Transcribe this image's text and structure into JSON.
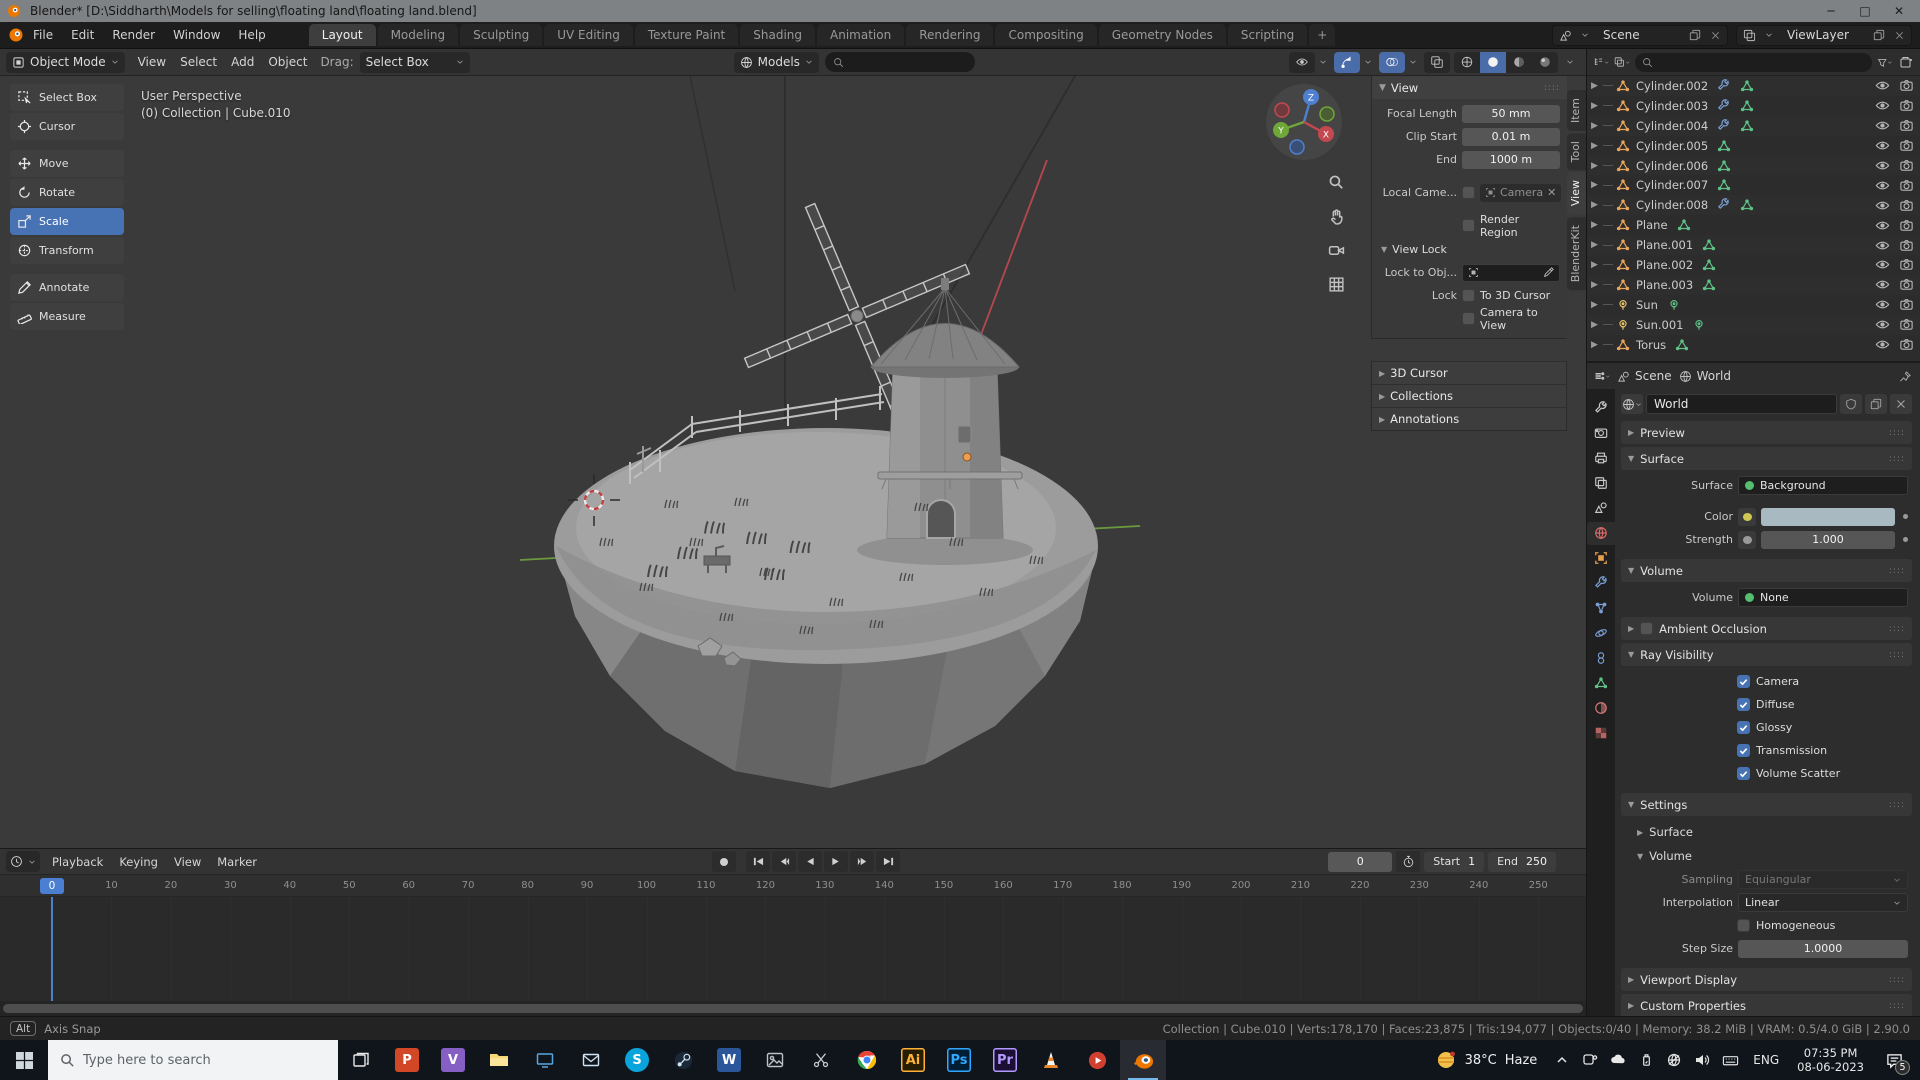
{
  "colors": {
    "accent": "#4772b3",
    "playhead": "#4a7fd1",
    "mesh_orange": "#e9a55b",
    "data_green": "#5fc186",
    "modifier_blue": "#7b9fd4",
    "world_red": "#d96c6c",
    "swatch": "#a9b9c1"
  },
  "window": {
    "title": "Blender* [D:\\Siddharth\\Models for selling\\floating land\\floating land.blend]",
    "minimize": "─",
    "maximize": "□",
    "close": "✕"
  },
  "menubar": {
    "menus": [
      "File",
      "Edit",
      "Render",
      "Window",
      "Help"
    ],
    "workspace_tabs": [
      "Layout",
      "Modeling",
      "Sculpting",
      "UV Editing",
      "Texture Paint",
      "Shading",
      "Animation",
      "Rendering",
      "Compositing",
      "Geometry Nodes",
      "Scripting"
    ],
    "active_tab": "Layout",
    "add_tab": "+",
    "scene_selector": "Scene",
    "viewlayer_selector": "ViewLayer"
  },
  "viewport_header": {
    "mode": "Object Mode",
    "menus": [
      "View",
      "Select",
      "Add",
      "Object"
    ],
    "drag_label": "Drag:",
    "drag_value": "Select Box",
    "asset_lib": "Models"
  },
  "toolbar": {
    "tools": [
      {
        "label": "Select Box",
        "icon": "select-box",
        "active": false,
        "gap": false
      },
      {
        "label": "Cursor",
        "icon": "cursor",
        "active": false,
        "gap": false
      },
      {
        "label": "Move",
        "icon": "move",
        "active": false,
        "gap": true
      },
      {
        "label": "Rotate",
        "icon": "rotate",
        "active": false,
        "gap": false
      },
      {
        "label": "Scale",
        "icon": "scale",
        "active": true,
        "gap": false
      },
      {
        "label": "Transform",
        "icon": "transform",
        "active": false,
        "gap": false
      },
      {
        "label": "Annotate",
        "icon": "annotate",
        "active": false,
        "gap": true
      },
      {
        "label": "Measure",
        "icon": "measure",
        "active": false,
        "gap": false
      }
    ]
  },
  "viewport": {
    "overlay_line1": "User Perspective",
    "overlay_line2": "(0) Collection | Cube.010",
    "gizmo_axes": {
      "x": "X",
      "y": "Y",
      "z": "Z"
    }
  },
  "npanel": {
    "tabs": [
      "Item",
      "Tool",
      "View",
      "BlenderKit"
    ],
    "active_tab": "View",
    "view": {
      "title": "View",
      "focal_length_label": "Focal Length",
      "focal_length": "50 mm",
      "clip_start_label": "Clip Start",
      "clip_start": "0.01 m",
      "end_label": "End",
      "end": "1000 m",
      "local_camera_label": "Local Came...",
      "camera_value": "Camera",
      "render_region_label": "Render Region",
      "view_lock_title": "View Lock",
      "lock_to_obj_label": "Lock to Obj...",
      "lock_label": "Lock",
      "to_3d_cursor_label": "To 3D Cursor",
      "camera_to_view_label": "Camera to View"
    },
    "collapsed_panels": [
      "3D Cursor",
      "Collections",
      "Annotations"
    ]
  },
  "outliner": {
    "rows": [
      {
        "name": "Cylinder.002",
        "type": "mesh",
        "wrench": true
      },
      {
        "name": "Cylinder.003",
        "type": "mesh",
        "wrench": true
      },
      {
        "name": "Cylinder.004",
        "type": "mesh",
        "wrench": true
      },
      {
        "name": "Cylinder.005",
        "type": "mesh",
        "wrench": false
      },
      {
        "name": "Cylinder.006",
        "type": "mesh",
        "wrench": false
      },
      {
        "name": "Cylinder.007",
        "type": "mesh",
        "wrench": false
      },
      {
        "name": "Cylinder.008",
        "type": "mesh",
        "wrench": true
      },
      {
        "name": "Plane",
        "type": "mesh",
        "wrench": false
      },
      {
        "name": "Plane.001",
        "type": "mesh",
        "wrench": false
      },
      {
        "name": "Plane.002",
        "type": "mesh",
        "wrench": false
      },
      {
        "name": "Plane.003",
        "type": "mesh",
        "wrench": false
      },
      {
        "name": "Sun",
        "type": "light",
        "wrench": false
      },
      {
        "name": "Sun.001",
        "type": "light",
        "wrench": false
      },
      {
        "name": "Torus",
        "type": "mesh",
        "wrench": false
      }
    ]
  },
  "properties": {
    "breadcrumb_scene": "Scene",
    "breadcrumb_world": "World",
    "world_block_name": "World",
    "preview_title": "Preview",
    "surface": {
      "title": "Surface",
      "surface_label": "Surface",
      "surface_value": "Background",
      "color_label": "Color",
      "strength_label": "Strength",
      "strength_value": "1.000"
    },
    "volume": {
      "title": "Volume",
      "label": "Volume",
      "value": "None"
    },
    "ao_title": "Ambient Occlusion",
    "ray_visibility": {
      "title": "Ray Visibility",
      "items": [
        {
          "label": "Camera",
          "checked": true
        },
        {
          "label": "Diffuse",
          "checked": true
        },
        {
          "label": "Glossy",
          "checked": true
        },
        {
          "label": "Transmission",
          "checked": true
        },
        {
          "label": "Volume Scatter",
          "checked": true
        }
      ]
    },
    "settings": {
      "title": "Settings",
      "surface_sub": "Surface",
      "volume_sub": "Volume",
      "sampling_label": "Sampling",
      "sampling_value": "Equiangular",
      "interpolation_label": "Interpolation",
      "interpolation_value": "Linear",
      "homogeneous_label": "Homogeneous",
      "step_size_label": "Step Size",
      "step_size_value": "1.0000"
    },
    "viewport_display_title": "Viewport Display",
    "custom_properties_title": "Custom Properties",
    "tabs": [
      {
        "name": "tool",
        "color": "#c8c8c8",
        "active": false
      },
      {
        "name": "render",
        "color": "#c8c8c8",
        "active": false
      },
      {
        "name": "output",
        "color": "#c8c8c8",
        "active": false
      },
      {
        "name": "view-layer",
        "color": "#c8c8c8",
        "active": false
      },
      {
        "name": "scene",
        "color": "#c8c8c8",
        "active": false
      },
      {
        "name": "world",
        "color": "#d96c6c",
        "active": true
      },
      {
        "name": "object",
        "color": "#e8a04c",
        "active": false
      },
      {
        "name": "modifiers",
        "color": "#7b9fd4",
        "active": false
      },
      {
        "name": "particles",
        "color": "#7b9fd4",
        "active": false
      },
      {
        "name": "physics",
        "color": "#7b9fd4",
        "active": false
      },
      {
        "name": "constraints",
        "color": "#7b9fd4",
        "active": false
      },
      {
        "name": "object-data",
        "color": "#5fc186",
        "active": false
      },
      {
        "name": "material",
        "color": "#d97a7a",
        "active": false
      },
      {
        "name": "texture",
        "color": "#c96a6a",
        "active": false
      }
    ]
  },
  "timeline": {
    "menus": [
      "Playback",
      "Keying",
      "View",
      "Marker"
    ],
    "current_frame": "0",
    "start_label": "Start",
    "start_value": "1",
    "end_label": "End",
    "end_value": "250",
    "ticks": [
      10,
      20,
      30,
      40,
      50,
      60,
      70,
      80,
      90,
      100,
      110,
      120,
      130,
      140,
      150,
      160,
      170,
      180,
      190,
      200,
      210,
      220,
      230,
      240,
      250
    ]
  },
  "statusbar": {
    "key_hint": "Alt",
    "hint": "Axis Snap",
    "stats": "Collection | Cube.010 | Verts:178,170 | Faces:23,875 | Tris:194,077 | Objects:0/40 | Memory: 38.2 MiB | VRAM: 0.5/4.0 GiB | 2.90.0"
  },
  "taskbar": {
    "search_placeholder": "Type here to search",
    "apps": [
      {
        "name": "task-view",
        "label": ""
      },
      {
        "name": "powerpoint",
        "label": "P"
      },
      {
        "name": "visual-studio",
        "label": "V"
      },
      {
        "name": "file-explorer",
        "label": ""
      },
      {
        "name": "movies-tv",
        "label": ""
      },
      {
        "name": "mail",
        "label": ""
      },
      {
        "name": "skype",
        "label": "S"
      },
      {
        "name": "steam",
        "label": ""
      },
      {
        "name": "word",
        "label": "W"
      },
      {
        "name": "photos",
        "label": ""
      },
      {
        "name": "snip",
        "label": ""
      },
      {
        "name": "chrome",
        "label": ""
      },
      {
        "name": "illustrator",
        "label": "Ai"
      },
      {
        "name": "photoshop",
        "label": "Ps"
      },
      {
        "name": "premiere-pro",
        "label": "Pr"
      },
      {
        "name": "vlc",
        "label": ""
      },
      {
        "name": "media-red",
        "label": ""
      },
      {
        "name": "blender",
        "label": "",
        "active": true
      }
    ],
    "tray": {
      "temperature": "38°C",
      "condition": "Haze",
      "language": "ENG",
      "time": "07:35 PM",
      "date": "08-06-2023",
      "notification_count": "5"
    }
  }
}
